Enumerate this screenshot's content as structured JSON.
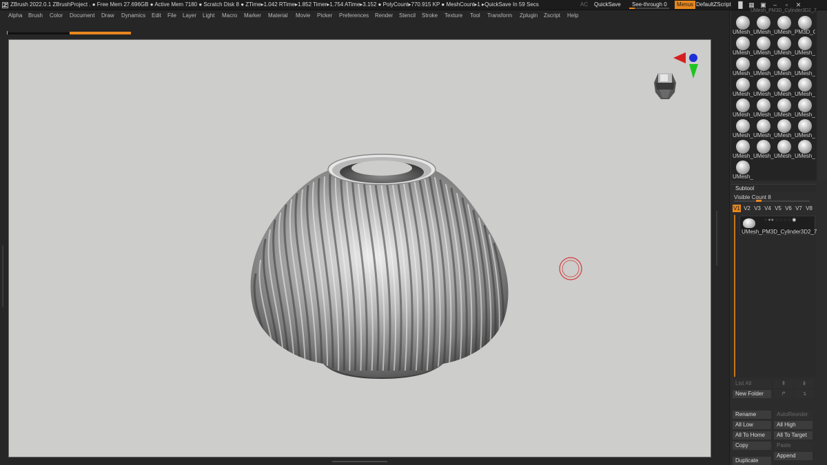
{
  "titlebar": {
    "status": "ZBrush 2022.0.1   ZBrushProject   . ● Free Mem 27.696GB ● Active Mem 7180 ● Scratch Disk 8 ●  ZTime▸1.042 RTime▸1.852 Timer▸1.754 ATime▸3.152 ● PolyCount▸770.915 KP  ● MeshCount▸1   ▸QuickSave In 59 Secs",
    "ac": "AC",
    "quicksave": "QuickSave",
    "seethrough": "See-through  0",
    "menus": "Menus",
    "script": "DefaultZScript",
    "accent": "#e8871e"
  },
  "menubar": {
    "items": [
      "Alpha",
      "Brush",
      "Color",
      "Document",
      "Draw",
      "Dynamics",
      "Edit",
      "File",
      "Layer",
      "Light",
      "Macro",
      "Marker",
      "Material",
      "Movie",
      "Picker",
      "Preferences",
      "Render",
      "Stencil",
      "Stroke",
      "Texture",
      "Tool",
      "Transform",
      "Zplugin",
      "Zscript",
      "Help"
    ]
  },
  "lightbox": {
    "header_fragment": "UMesh_PM3D_Cylinder3D2_7",
    "rows": [
      [
        "UMesh_",
        "UMesh_",
        "UMesh_",
        "PM3D_C"
      ],
      [
        "UMesh_",
        "UMesh_",
        "UMesh_",
        "UMesh_"
      ],
      [
        "UMesh_",
        "UMesh_",
        "UMesh_",
        "UMesh_"
      ],
      [
        "UMesh_",
        "UMesh_",
        "UMesh_",
        "UMesh_"
      ],
      [
        "UMesh_",
        "UMesh_",
        "UMesh_",
        "UMesh_"
      ],
      [
        "UMesh_",
        "UMesh_",
        "UMesh_",
        "UMesh_"
      ],
      [
        "UMesh_",
        "UMesh_",
        "UMesh_",
        "UMesh_"
      ],
      [
        "UMesh_"
      ]
    ]
  },
  "subtool": {
    "header": "Subtool",
    "visible_count": "Visible Count 8",
    "visible_count_value": 8,
    "versions": [
      "V1",
      "V2",
      "V3",
      "V4",
      "V5",
      "V6",
      "V7",
      "V8"
    ],
    "active_version": "V1",
    "item_name": "UMesh_PM3D_Cylinder3D2_7",
    "list_all": "List All",
    "new_folder": "New Folder",
    "rename": "Rename",
    "autoreorder": "AutoReorder",
    "all_low": "All Low",
    "all_high": "All High",
    "all_to_home": "All To Home",
    "all_to_target": "All To Target",
    "copy": "Copy",
    "paste": "Paste",
    "duplicate": "Duplicate",
    "append": "Append"
  }
}
